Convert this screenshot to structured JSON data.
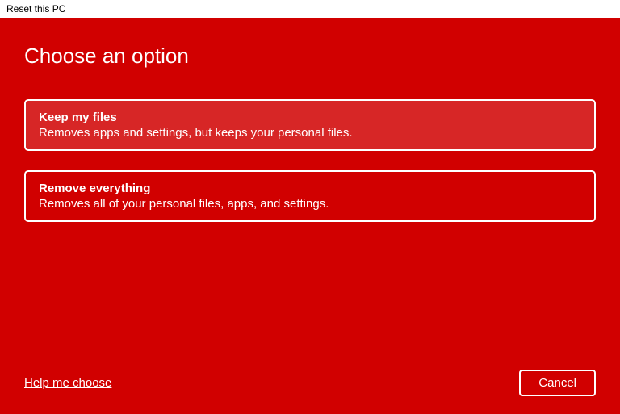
{
  "window": {
    "title": "Reset this PC"
  },
  "dialog": {
    "heading": "Choose an option"
  },
  "options": [
    {
      "title": "Keep my files",
      "description": "Removes apps and settings, but keeps your personal files."
    },
    {
      "title": "Remove everything",
      "description": "Removes all of your personal files, apps, and settings."
    }
  ],
  "footer": {
    "help_link": "Help me choose",
    "cancel_label": "Cancel"
  }
}
